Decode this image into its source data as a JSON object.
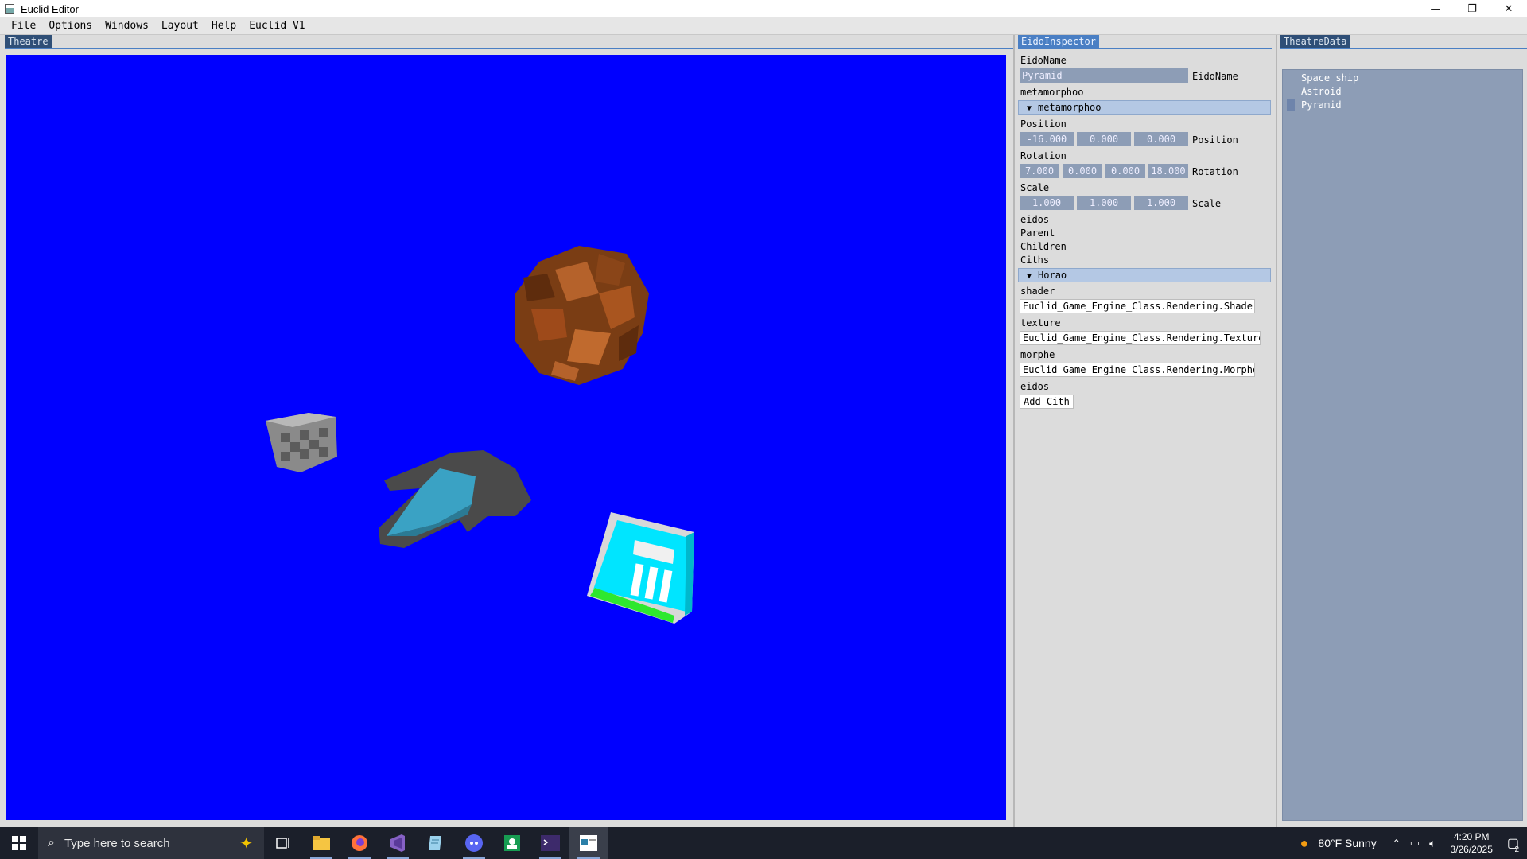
{
  "window": {
    "title": "Euclid Editor",
    "buttons": {
      "minimize": "—",
      "maximize": "❐",
      "close": "✕"
    }
  },
  "menubar": [
    "File",
    "Options",
    "Windows",
    "Layout",
    "Help",
    "Euclid V1"
  ],
  "panels": {
    "theatre_tab": "Theatre",
    "inspector_tab": "EidoInspector",
    "theatredata_tab": "TheatreData"
  },
  "theatre": {
    "background": "#0000ff"
  },
  "inspector": {
    "eidoname_label": "EidoName",
    "eidoname_value": "Pyramid",
    "eidoname_side": "EidoName",
    "metamorphoo_label": "metamorphoo",
    "metamorphoo_section": "metamorphoo",
    "position_label": "Position",
    "position": [
      "-16.000",
      "0.000",
      "0.000"
    ],
    "position_side": "Position",
    "rotation_label": "Rotation",
    "rotation": [
      "7.000",
      "0.000",
      "0.000",
      "18.000"
    ],
    "rotation_side": "Rotation",
    "scale_label": "Scale",
    "scale": [
      "1.000",
      "1.000",
      "1.000"
    ],
    "scale_side": "Scale",
    "eidos_label": "eidos",
    "parent_label": "Parent",
    "children_label": "Children",
    "ciths_label": "Ciths",
    "horao_section": "Horao",
    "shader_label": "shader",
    "shader_value": "Euclid_Game_Engine_Class.Rendering.Shader",
    "texture_label": "texture",
    "texture_value": "Euclid_Game_Engine_Class.Rendering.Texture",
    "morphe_label": "morphe",
    "morphe_value": "Euclid_Game_Engine_Class.Rendering.Morphe",
    "eidos2_label": "eidos",
    "add_cith": "Add Cith"
  },
  "theatredata": {
    "items": [
      "Space ship",
      "Astroid",
      "Pyramid"
    ],
    "selected": "Pyramid"
  },
  "taskbar": {
    "search_placeholder": "Type here to search",
    "weather": "80°F  Sunny",
    "time": "4:20 PM",
    "date": "3/26/2025",
    "notification_count": "2"
  }
}
